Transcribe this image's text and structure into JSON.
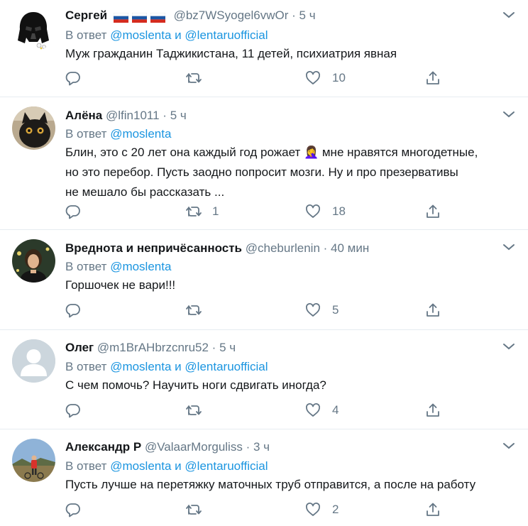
{
  "reply_prefix": "В ответ",
  "conjunction": "и",
  "tweets": [
    {
      "name": "Сергей",
      "handle": "@bz7WSyogel6vwOr",
      "time": "5 ч",
      "mentions": [
        "@moslenta",
        "@lentaruofficial"
      ],
      "text": "Муж гражданин Таджикистана, 11 детей, психиатрия явная",
      "retweets": "",
      "likes": "10",
      "flags": [
        "ru",
        "ru",
        "ru"
      ]
    },
    {
      "name": "Алёна",
      "handle": "@lfin1011",
      "time": "5 ч",
      "mentions": [
        "@moslenta"
      ],
      "text_lines": [
        "Блин, это с 20 лет она каждый год рожает 🤦‍♀️ мне нравятся многодетные,",
        "но это перебор. Пусть заодно попросит мозги. Ну и про презервативы",
        "не мешало бы рассказать ..."
      ],
      "retweets": "1",
      "likes": "18"
    },
    {
      "name": "Вреднота и непричёсанность",
      "handle": "@cheburlenin",
      "time": "40 мин",
      "mentions": [
        "@moslenta"
      ],
      "text": "Горшочек не вари!!!",
      "retweets": "",
      "likes": "5"
    },
    {
      "name": "Олег",
      "handle": "@m1BrAHbrzcnru52",
      "time": "5 ч",
      "mentions": [
        "@moslenta",
        "@lentaruofficial"
      ],
      "text": "С чем помочь? Научить ноги сдвигать иногда?",
      "retweets": "",
      "likes": "4"
    },
    {
      "name": "Александр Р",
      "handle": "@ValaarMorguliss",
      "time": "3 ч",
      "mentions": [
        "@moslenta",
        "@lentaruofficial"
      ],
      "text": "Пусть лучше на перетяжку маточных труб отправится, а после на работу",
      "retweets": "",
      "likes": "2"
    }
  ],
  "colors": {
    "text": "#14171a",
    "secondary": "#657786",
    "link": "#1b95e0",
    "icon": "#657786",
    "divider": "#e6ecf0"
  }
}
